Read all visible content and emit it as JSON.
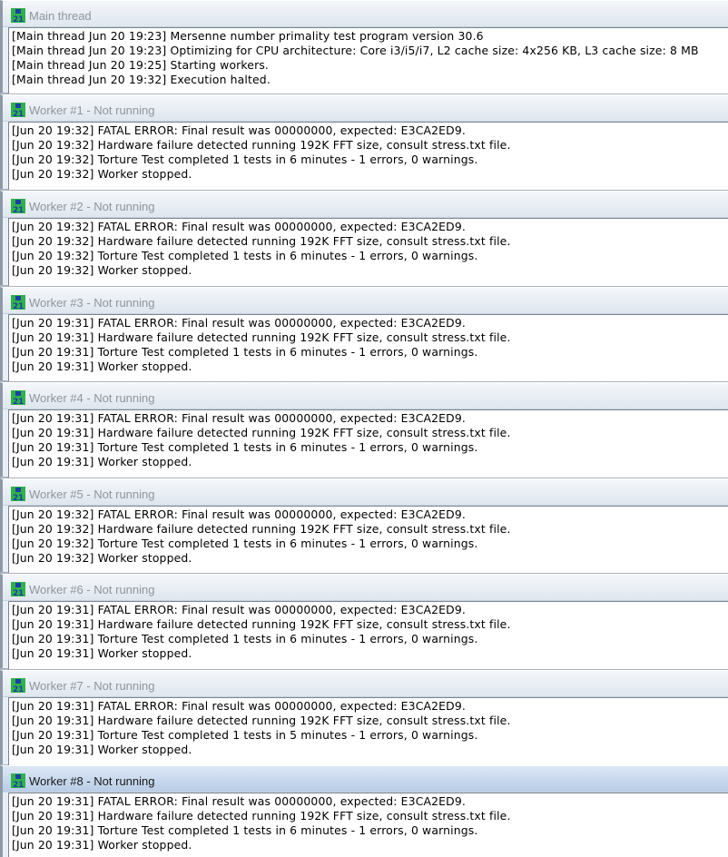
{
  "panels": [
    {
      "title": "Main thread",
      "active": false,
      "lines": [
        "[Main thread Jun 20 19:23] Mersenne number primality test program version 30.6",
        "[Main thread Jun 20 19:23] Optimizing for CPU architecture: Core i3/i5/i7, L2 cache size: 4x256 KB, L3 cache size: 8 MB",
        "[Main thread Jun 20 19:25] Starting workers.",
        "[Main thread Jun 20 19:32] Execution halted."
      ]
    },
    {
      "title": "Worker #1 - Not running",
      "active": false,
      "lines": [
        "[Jun 20 19:32] FATAL ERROR: Final result was 00000000, expected: E3CA2ED9.",
        "[Jun 20 19:32] Hardware failure detected running 192K FFT size, consult stress.txt file.",
        "[Jun 20 19:32] Torture Test completed 1 tests in 6 minutes - 1 errors, 0 warnings.",
        "[Jun 20 19:32] Worker stopped."
      ]
    },
    {
      "title": "Worker #2 - Not running",
      "active": false,
      "lines": [
        "[Jun 20 19:32] FATAL ERROR: Final result was 00000000, expected: E3CA2ED9.",
        "[Jun 20 19:32] Hardware failure detected running 192K FFT size, consult stress.txt file.",
        "[Jun 20 19:32] Torture Test completed 1 tests in 6 minutes - 1 errors, 0 warnings.",
        "[Jun 20 19:32] Worker stopped."
      ]
    },
    {
      "title": "Worker #3 - Not running",
      "active": false,
      "lines": [
        "[Jun 20 19:31] FATAL ERROR: Final result was 00000000, expected: E3CA2ED9.",
        "[Jun 20 19:31] Hardware failure detected running 192K FFT size, consult stress.txt file.",
        "[Jun 20 19:31] Torture Test completed 1 tests in 6 minutes - 1 errors, 0 warnings.",
        "[Jun 20 19:31] Worker stopped."
      ]
    },
    {
      "title": "Worker #4 - Not running",
      "active": false,
      "lines": [
        "[Jun 20 19:31] FATAL ERROR: Final result was 00000000, expected: E3CA2ED9.",
        "[Jun 20 19:31] Hardware failure detected running 192K FFT size, consult stress.txt file.",
        "[Jun 20 19:31] Torture Test completed 1 tests in 6 minutes - 1 errors, 0 warnings.",
        "[Jun 20 19:31] Worker stopped."
      ]
    },
    {
      "title": "Worker #5 - Not running",
      "active": false,
      "lines": [
        "[Jun 20 19:32] FATAL ERROR: Final result was 00000000, expected: E3CA2ED9.",
        "[Jun 20 19:32] Hardware failure detected running 192K FFT size, consult stress.txt file.",
        "[Jun 20 19:32] Torture Test completed 1 tests in 6 minutes - 1 errors, 0 warnings.",
        "[Jun 20 19:32] Worker stopped."
      ]
    },
    {
      "title": "Worker #6 - Not running",
      "active": false,
      "lines": [
        "[Jun 20 19:31] FATAL ERROR: Final result was 00000000, expected: E3CA2ED9.",
        "[Jun 20 19:31] Hardware failure detected running 192K FFT size, consult stress.txt file.",
        "[Jun 20 19:31] Torture Test completed 1 tests in 6 minutes - 1 errors, 0 warnings.",
        "[Jun 20 19:31] Worker stopped."
      ]
    },
    {
      "title": "Worker #7 - Not running",
      "active": false,
      "lines": [
        "[Jun 20 19:31] FATAL ERROR: Final result was 00000000, expected: E3CA2ED9.",
        "[Jun 20 19:31] Hardware failure detected running 192K FFT size, consult stress.txt file.",
        "[Jun 20 19:31] Torture Test completed 1 tests in 5 minutes - 1 errors, 0 warnings.",
        "[Jun 20 19:31] Worker stopped."
      ]
    },
    {
      "title": "Worker #8 - Not running",
      "active": true,
      "lines": [
        "[Jun 20 19:31] FATAL ERROR: Final result was 00000000, expected: E3CA2ED9.",
        "[Jun 20 19:31] Hardware failure detected running 192K FFT size, consult stress.txt file.",
        "[Jun 20 19:31] Torture Test completed 1 tests in 6 minutes - 1 errors, 0 warnings.",
        "[Jun 20 19:31] Worker stopped."
      ]
    }
  ],
  "icon": "prime95-icon",
  "colors": {
    "title_inactive": "#8f959c",
    "title_active": "#1a1a1a",
    "icon_green": "#2fb24a",
    "icon_blue": "#1d3fa8"
  }
}
